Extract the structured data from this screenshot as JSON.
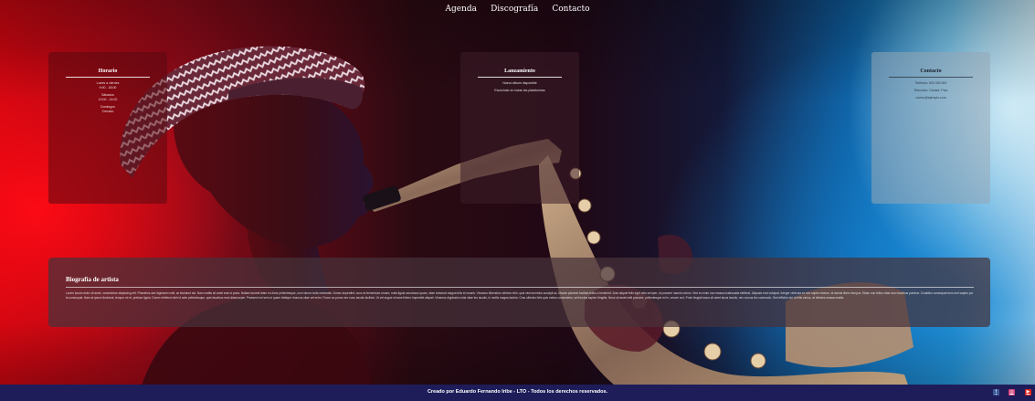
{
  "nav": {
    "items": [
      "Agenda",
      "Discografía",
      "Contacto"
    ]
  },
  "cards": {
    "horario": {
      "title": "Horario",
      "lines": [
        "Lunes a viernes",
        "9:00 - 18:00",
        "Sábados",
        "10:00 - 14:00",
        "Domingos",
        "Cerrado"
      ]
    },
    "lanzamiento": {
      "title": "Lanzamiento",
      "lines": [
        "Nuevo álbum disponible",
        "Escúchalo en todas las plataformas"
      ]
    },
    "contacto": {
      "title": "Contacto",
      "lines": [
        "Teléfono: 000 000 000",
        "Dirección: Ciudad, País",
        "correo@ejemplo.com"
      ]
    }
  },
  "bio": {
    "title": "Biografía de artista",
    "text": "Lorem ipsum dolor sit amet, consectetur adipiscing elit. Phasellus sed dignissim velit, ac tincidunt dui. Nam mattis sit amet erat ut porta. Nullam laoreet diam eu dolor pellentesque, non rutrum nulla venenatis. Donec imperdiet, nunc at fermentum ornare, nulla ligula accumsan quam, vitae euismod magna felis id mauris. Vivamus bibendum ultrices nibh, quis viverra lectus suscipit ac. Mauris placerat facilisis tellus a hendrerit. Duis aliquet felis eget odio semper, ut posuere mauris rutrum. Sed eu enim non massa malesuada eleifend. Aliquam erat volutpat. Integer vehicula ex nec sapien dictum, at lacinia libero tempus. Etiam non tellus vitae arcu faucibus pulvinar. Curabitur consequat eros sed sapien porta consequat. Nam at ipsum tincidunt, tempor mi et, pretium ligula. Donec eleifend nibh id ante pellentesque, quis faucibus erat ullamcorper. Praesent vel sem ut quam tristique rhoncus vitae vel enim. Fusce ac purus nec nunc iaculis facilisis. Ut vel augue sit amet libero imperdiet aliquet. Vivamus dignissim nulla vitae leo iaculis, in mollis magna lacinia. Cras ultricies felis quis metus consectetur, sed luctus sapien fringilla. Nunc sit amet velit posuere, pellentesque mi in, ornare orci. Proin feugiat lacus sit amet lacus iaculis, nec cursus leo commodo. Sed efficitur dui ut felis varius, at ultricies massa mattis."
  },
  "footer": {
    "text": "Creado por Eduardo Fernando Iribe - LTO - Todos los derechos reservados.",
    "social": [
      "f",
      "ig",
      "yt"
    ]
  },
  "colors": {
    "footer_bg": "#1e1d5a",
    "facebook": "#3b5998",
    "instagram": "#d6407a",
    "youtube": "#e0201a"
  }
}
